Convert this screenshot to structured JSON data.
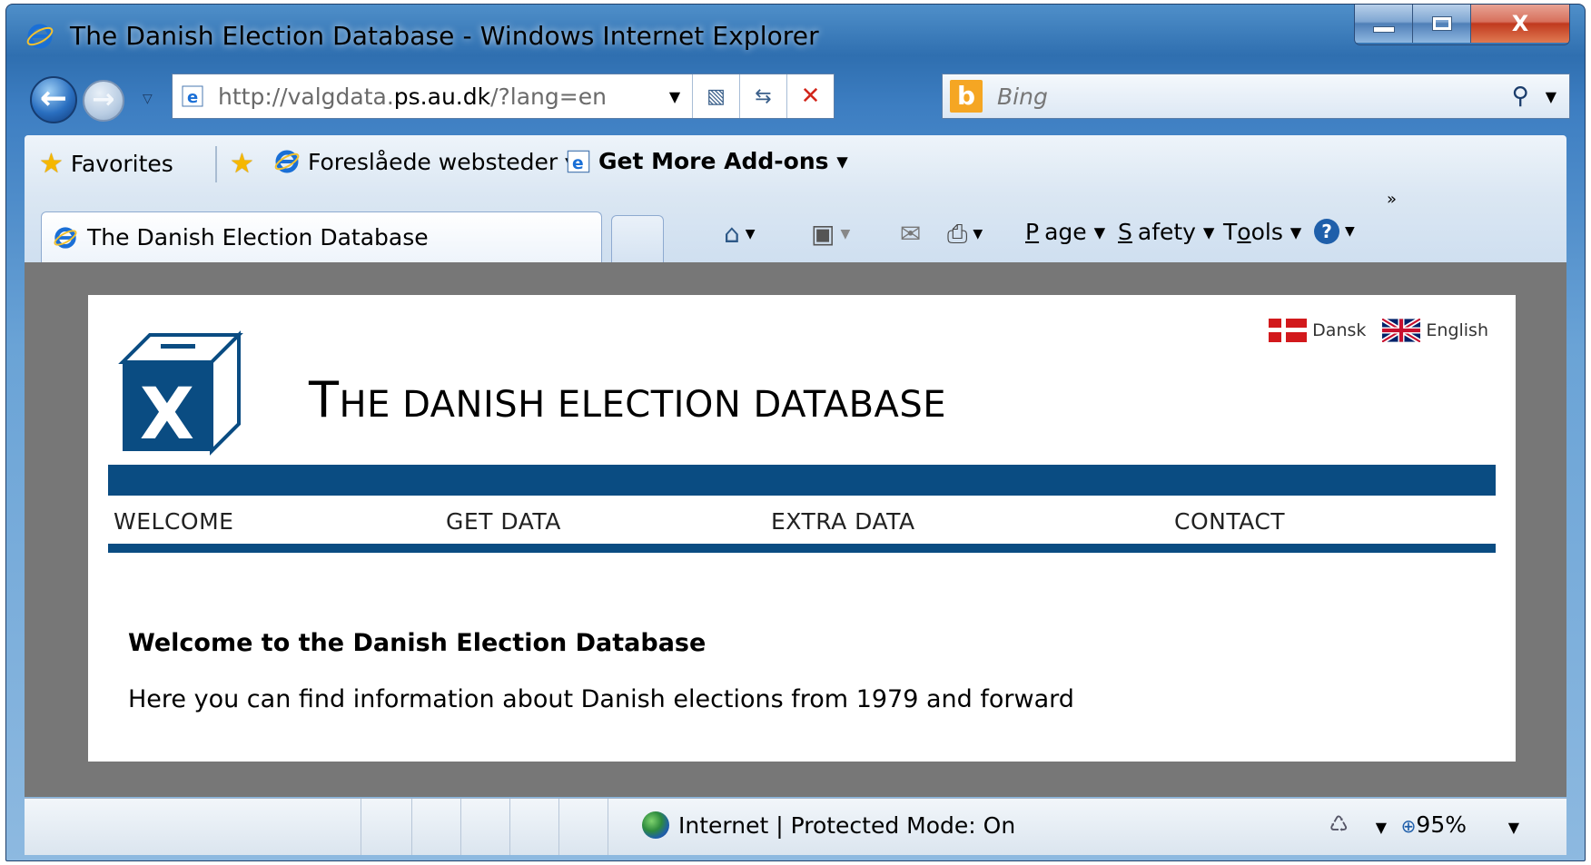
{
  "window": {
    "title": "The Danish Election Database - Windows Internet Explorer",
    "controls": {
      "minimize": "",
      "maximize": "",
      "close": "X"
    }
  },
  "nav": {
    "back_symbol": "←",
    "forward_symbol": "→",
    "address_prefix": "http://valgdata.",
    "address_domain": "ps.au.dk",
    "address_suffix": "/?lang=en",
    "search_placeholder": "Bing",
    "search_logo": "b"
  },
  "favorites_bar": {
    "favorites_label": "Favorites",
    "suggested_sites_label": "Foreslåede websteder ▾",
    "addons_label": "Get More Add-ons ▾"
  },
  "tabs": [
    {
      "label": "The Danish Election Database"
    }
  ],
  "command_bar": {
    "page_label_u": "P",
    "page_label_rest": "age ▾",
    "safety_label_u": "S",
    "safety_label_rest": "afety ▾",
    "tools_label_pre": "T",
    "tools_label_u": "o",
    "tools_label_rest": "ols ▾",
    "help_symbol": "?",
    "chevron": "»"
  },
  "site": {
    "logo_letter": "X",
    "title_first": "T",
    "title_rest": "HE DANISH ELECTION DATABASE",
    "languages": [
      {
        "label": "Dansk"
      },
      {
        "label": "English"
      }
    ],
    "menu": [
      {
        "label": "WELCOME"
      },
      {
        "label": "GET DATA"
      },
      {
        "label": "EXTRA DATA"
      },
      {
        "label": "CONTACT"
      }
    ],
    "welcome_heading": "Welcome to the Danish Election Database",
    "welcome_text": "Here you can find information about Danish elections from 1979 and forward"
  },
  "status_bar": {
    "zone_text": "Internet | Protected Mode: On",
    "zoom": "95%"
  },
  "colors": {
    "brand_blue": "#0a4c82",
    "viewport_gray": "#777777",
    "ie_frame": "#3d7ec2"
  }
}
